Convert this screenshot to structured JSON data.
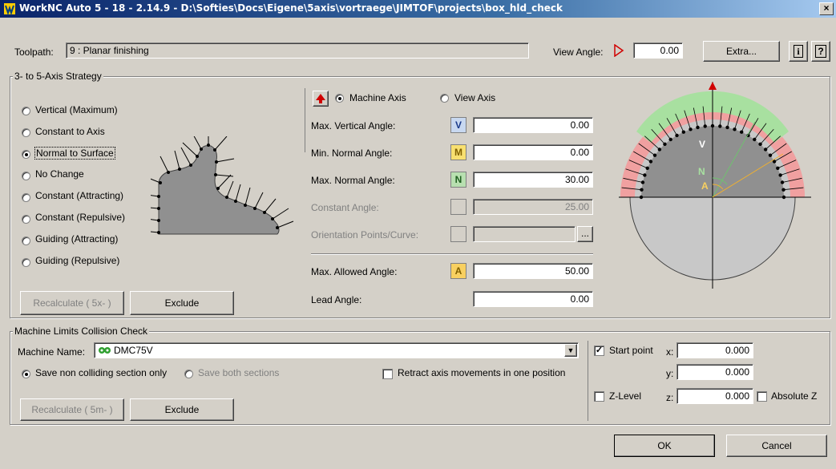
{
  "window": {
    "title": "WorkNC Auto 5 - 18 - 2.14.9 - D:\\Softies\\Docs\\Eigene\\5axis\\vortraege\\JIMTOF\\projects\\box_hld_check",
    "close": "×"
  },
  "toolpath": {
    "label": "Toolpath:",
    "value": "9  :  Planar finishing"
  },
  "view_angle": {
    "label": "View Angle:",
    "value": "0.00"
  },
  "buttons": {
    "extra": "Extra...",
    "info": "i",
    "help": "?",
    "ok": "OK",
    "cancel": "Cancel"
  },
  "strategy": {
    "title": "3- to 5-Axis Strategy",
    "options": [
      "Vertical (Maximum)",
      "Constant to Axis",
      "Normal to Surface",
      "No Change",
      "Constant (Attracting)",
      "Constant (Repulsive)",
      "Guiding (Attracting)",
      "Guiding (Repulsive)"
    ],
    "selected": 2,
    "recalc": "Recalculate ( 5x- )",
    "exclude": "Exclude"
  },
  "axis": {
    "machine": "Machine Axis",
    "view": "View Axis"
  },
  "angles": {
    "max_vertical": {
      "label": "Max. Vertical Angle:",
      "badge": "V",
      "value": "0.00"
    },
    "min_normal": {
      "label": "Min. Normal Angle:",
      "badge": "M",
      "value": "0.00"
    },
    "max_normal": {
      "label": "Max. Normal Angle:",
      "badge": "N",
      "value": "30.00"
    },
    "constant": {
      "label": "Constant Angle:",
      "value": "25.00"
    },
    "orientation": {
      "label": "Orientation Points/Curve:",
      "browse": "..."
    },
    "max_allowed": {
      "label": "Max. Allowed Angle:",
      "badge": "A",
      "value": "50.00"
    },
    "lead": {
      "label": "Lead Angle:",
      "value": "0.00"
    }
  },
  "diagram": {
    "v": "V",
    "n": "N",
    "a": "A"
  },
  "collision": {
    "title": "Machine Limits Collision Check",
    "machine_label": "Machine Name:",
    "machine_value": "DMC75V",
    "save_non": "Save non colliding section only",
    "save_both": "Save both sections",
    "retract": "Retract axis movements in one position",
    "recalc": "Recalculate ( 5m- )",
    "exclude": "Exclude",
    "start_point": "Start point",
    "x_label": "x:",
    "x": "0.000",
    "y_label": "y:",
    "y": "0.000",
    "z_level": "Z-Level",
    "z_label": "z:",
    "z": "0.000",
    "absolute_z": "Absolute Z"
  },
  "colors": {
    "v_badge": "#c8d8f0",
    "m_badge": "#f8e070",
    "n_badge": "#b8e0b0",
    "a_badge": "#f8d060",
    "green_zone": "#a8e0a0",
    "red_zone": "#f0a0a0"
  }
}
